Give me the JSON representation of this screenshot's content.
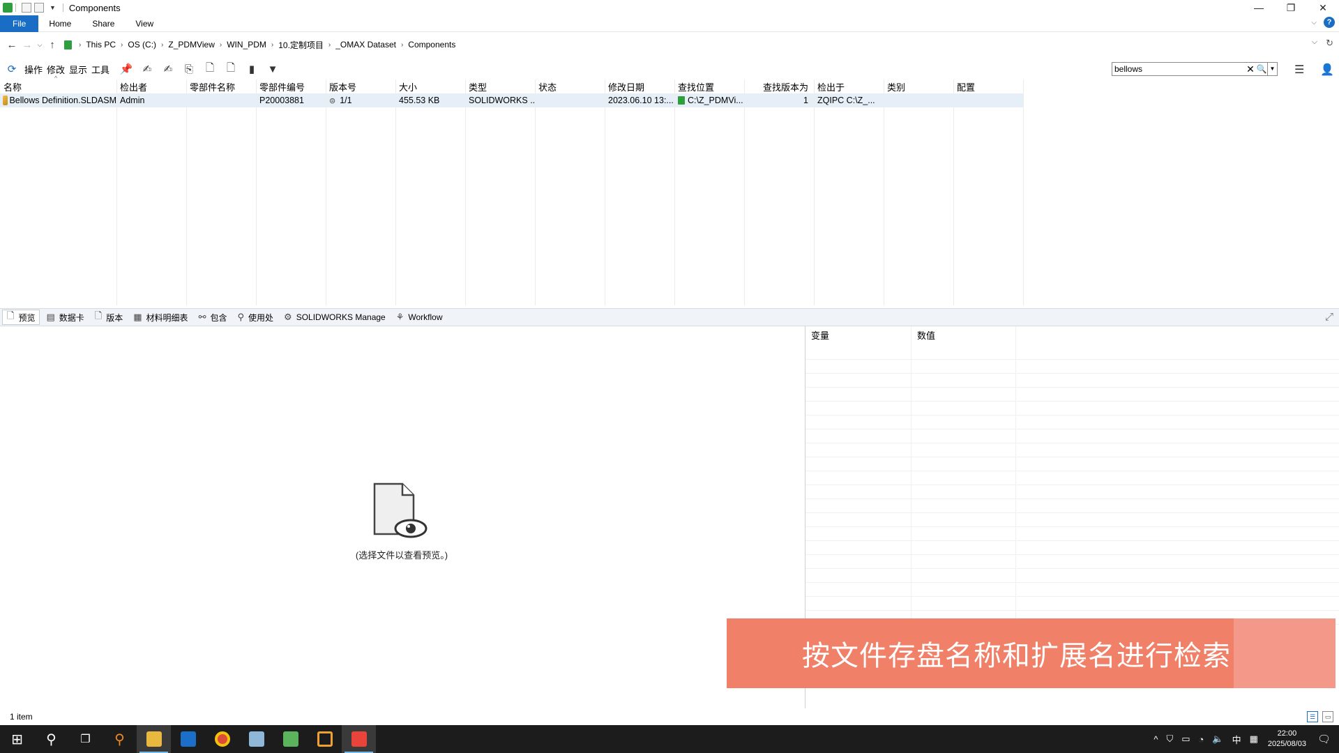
{
  "window": {
    "title": "Components",
    "controls": {
      "minimize": "—",
      "restore": "❐",
      "close": "✕"
    }
  },
  "ribbon": {
    "tabs": [
      "File",
      "Home",
      "Share",
      "View"
    ],
    "help": "?"
  },
  "address": {
    "crumbs": [
      "This PC",
      "OS (C:)",
      "Z_PDMView",
      "WIN_PDM",
      "10.定制项目",
      "_OMAX Dataset",
      "Components"
    ]
  },
  "toolbar": {
    "menus": [
      "操作",
      "修改",
      "显示",
      "工具"
    ],
    "search": {
      "value": "bellows",
      "placeholder": ""
    }
  },
  "filelist": {
    "columns": [
      "名称",
      "检出者",
      "零部件名称",
      "零部件编号",
      "版本号",
      "大小",
      "类型",
      "状态",
      "修改日期",
      "查找位置",
      "查找版本为",
      "检出于",
      "类别",
      "配置"
    ],
    "rows": [
      {
        "name": "Bellows Definition.SLDASM",
        "checked_out_by": "Admin",
        "part_name": "",
        "part_number": "P20003881",
        "version": "1/1",
        "size": "455.53 KB",
        "type": "SOLIDWORKS ...",
        "state": "",
        "modified": "2023.06.10 13:...",
        "found_in": "C:\\Z_PDMVi...",
        "found_version": "1",
        "checked_out_on": "ZQIPC   C:\\Z_...",
        "category": "",
        "configuration": ""
      }
    ]
  },
  "bottom_tabs": [
    "预览",
    "数据卡",
    "版本",
    "材料明细表",
    "包含",
    "使用处",
    "SOLIDWORKS Manage",
    "Workflow"
  ],
  "preview": {
    "message": "(选择文件以查看预览。)"
  },
  "variables": {
    "columns": [
      "变量",
      "数值"
    ]
  },
  "caption": "按文件存盘名称和扩展名进行检索",
  "status": {
    "count": "1 item"
  },
  "taskbar": {
    "ime": "中",
    "time": "22:00",
    "date": "2025/08/03"
  }
}
